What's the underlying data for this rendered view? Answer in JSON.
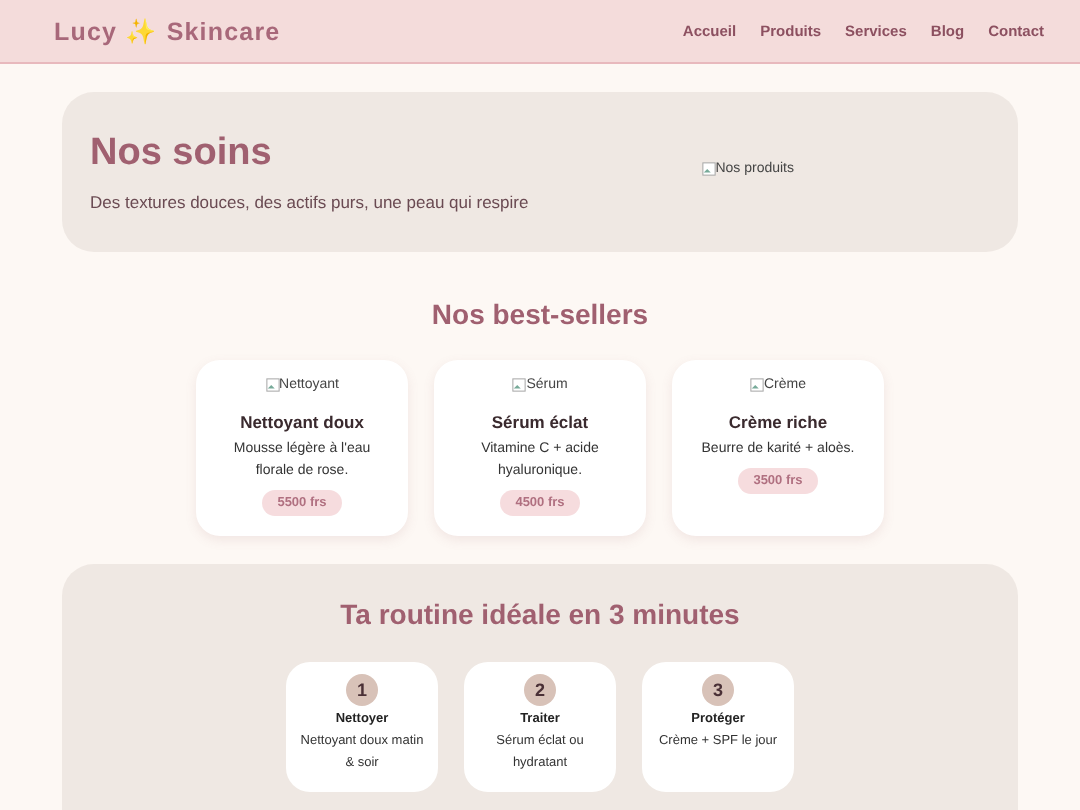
{
  "header": {
    "logo": "Lucy ✨ Skincare",
    "nav": [
      "Accueil",
      "Produits",
      "Services",
      "Blog",
      "Contact"
    ]
  },
  "hero": {
    "title": "Nos soins",
    "subtitle": "Des textures douces, des actifs purs, une peau qui respire",
    "image_alt": "Nos produits"
  },
  "bestsellers": {
    "title": "Nos best-sellers",
    "products": [
      {
        "image_alt": "Nettoyant",
        "name": "Nettoyant doux",
        "description": "Mousse légère à l'eau florale de rose.",
        "price": "5500 frs"
      },
      {
        "image_alt": "Sérum",
        "name": "Sérum éclat",
        "description": "Vitamine C + acide hyaluronique.",
        "price": "4500 frs"
      },
      {
        "image_alt": "Crème",
        "name": "Crème riche",
        "description": "Beurre de karité + aloès.",
        "price": "3500 frs"
      }
    ]
  },
  "routine": {
    "title": "Ta routine idéale en 3 minutes",
    "steps": [
      {
        "number": "1",
        "name": "Nettoyer",
        "description": "Nettoyant doux matin & soir"
      },
      {
        "number": "2",
        "name": "Traiter",
        "description": "Sérum éclat ou hydratant"
      },
      {
        "number": "3",
        "name": "Protéger",
        "description": "Crème + SPF le jour"
      }
    ]
  }
}
